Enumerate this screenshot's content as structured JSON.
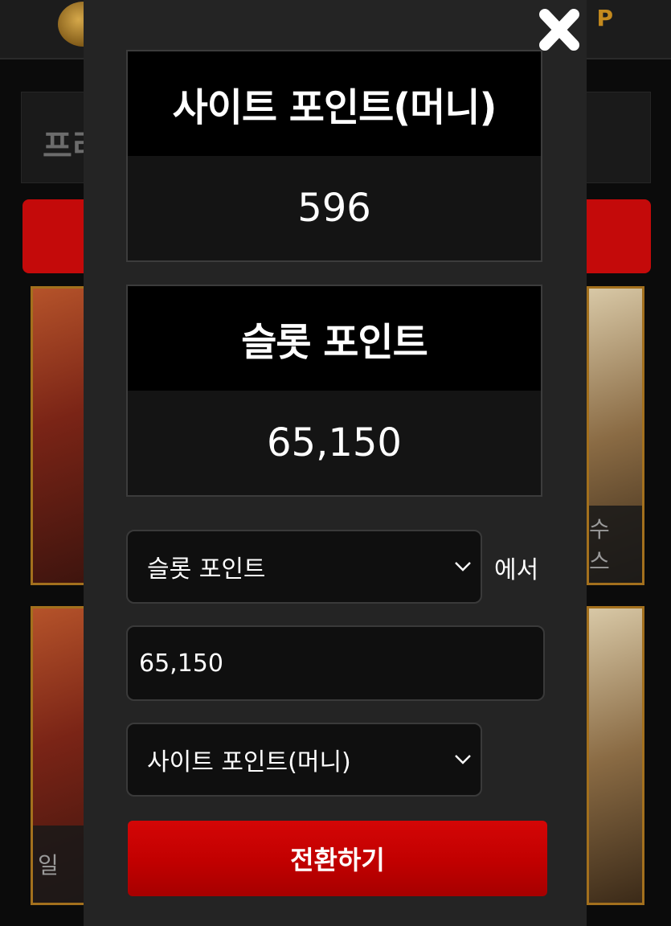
{
  "background": {
    "header_right_text": "P",
    "title_partial": "프리",
    "tile_labels": [
      "수스",
      "일"
    ]
  },
  "modal": {
    "site_points": {
      "title": "사이트 포인트(머니)",
      "value": "596"
    },
    "slot_points": {
      "title": "슬롯 포인트",
      "value": "65,150"
    },
    "from_select": {
      "value": "슬롯 포인트"
    },
    "from_suffix": "에서",
    "amount_input": {
      "value": "65,150"
    },
    "to_select": {
      "value": "사이트 포인트(머니)"
    },
    "submit_label": "전환하기",
    "close_icon": "close-icon"
  },
  "colors": {
    "modal_bg": "#242424",
    "card_header": "#000000",
    "button_red": "#c10000"
  }
}
